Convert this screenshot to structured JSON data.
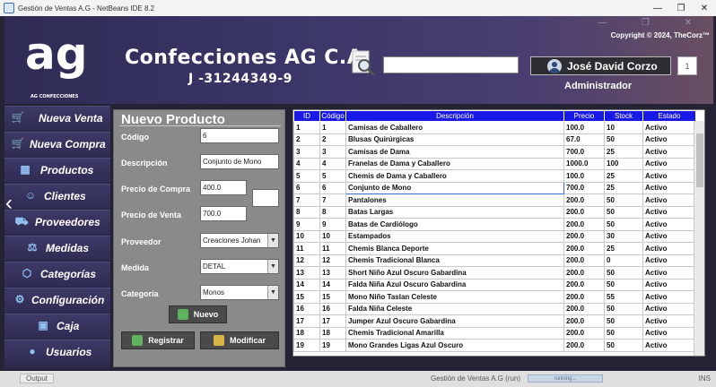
{
  "window": {
    "title": "Gestión de Ventas A.G - NetBeans IDE 8.2",
    "min": "—",
    "max": "❐",
    "close": "✕"
  },
  "header": {
    "logo": "ag",
    "logo_small": "AG CONFECCIONES",
    "company": "Confecciones AG C.A",
    "rif": "J -31244349-9",
    "copyright": "Copyright © 2024, TheCorz™",
    "search_value": "",
    "user_name": "José David Corzo",
    "count": "1",
    "role": "Administrador"
  },
  "sidebar": {
    "items": [
      {
        "label": "Nueva Venta",
        "icon": "cart-icon"
      },
      {
        "label": "Nueva Compra",
        "icon": "cart-add-icon"
      },
      {
        "label": "Productos",
        "icon": "products-icon"
      },
      {
        "label": "Clientes",
        "icon": "clients-icon"
      },
      {
        "label": "Proveedores",
        "icon": "providers-icon"
      },
      {
        "label": "Medidas",
        "icon": "measures-icon"
      },
      {
        "label": "Categorías",
        "icon": "categories-icon"
      },
      {
        "label": "Configuración",
        "icon": "gear-icon"
      },
      {
        "label": "Caja",
        "icon": "cashbox-icon"
      },
      {
        "label": "Usuarios",
        "icon": "users-icon"
      }
    ]
  },
  "form": {
    "title": "Nuevo Producto",
    "codigo_label": "Código",
    "codigo_value": "6",
    "descripcion_label": "Descripción",
    "descripcion_value": "Conjunto de Mono",
    "precio_compra_label": "Precio de Compra",
    "precio_compra_value": "400.0",
    "precio_venta_label": "Precio de Venta",
    "precio_venta_value": "700.0",
    "proveedor_label": "Proveedor",
    "proveedor_value": "Creaciones Johan",
    "medida_label": "Medida",
    "medida_value": "DETAL",
    "categoria_label": "Categoría",
    "categoria_value": "Monos",
    "nuevo_label": "Nuevo",
    "registrar_label": "Registrar",
    "modificar_label": "Modificar"
  },
  "table": {
    "headers": [
      "ID",
      "Código",
      "Descripción",
      "Precio",
      "Stock",
      "Estado"
    ],
    "rows": [
      [
        "1",
        "1",
        "Camisas de Caballero",
        "100.0",
        "10",
        "Activo"
      ],
      [
        "2",
        "2",
        "Blusas Quirúrgicas",
        "67.0",
        "50",
        "Activo"
      ],
      [
        "3",
        "3",
        "Camisas de Dama",
        "700.0",
        "25",
        "Activo"
      ],
      [
        "4",
        "4",
        "Franelas de Dama y Caballero",
        "1000.0",
        "100",
        "Activo"
      ],
      [
        "5",
        "5",
        "Chemis de Dama y Caballero",
        "100.0",
        "25",
        "Activo"
      ],
      [
        "6",
        "6",
        "Conjunto de Mono",
        "700.0",
        "25",
        "Activo"
      ],
      [
        "7",
        "7",
        "Pantalones",
        "200.0",
        "50",
        "Activo"
      ],
      [
        "8",
        "8",
        "Batas Largas",
        "200.0",
        "50",
        "Activo"
      ],
      [
        "9",
        "9",
        "Batas de Cardiólogo",
        "200.0",
        "50",
        "Activo"
      ],
      [
        "10",
        "10",
        "Estampados",
        "200.0",
        "30",
        "Activo"
      ],
      [
        "11",
        "11",
        "Chemis Blanca Deporte",
        "200.0",
        "25",
        "Activo"
      ],
      [
        "12",
        "12",
        "Chemis Tradicional Blanca",
        "200.0",
        "0",
        "Activo"
      ],
      [
        "13",
        "13",
        "Short Niño Azul Oscuro Gabardina",
        "200.0",
        "50",
        "Activo"
      ],
      [
        "14",
        "14",
        "Falda Niña Azul Oscuro Gabardina",
        "200.0",
        "50",
        "Activo"
      ],
      [
        "15",
        "15",
        "Mono Niño Taslan Celeste",
        "200.0",
        "55",
        "Activo"
      ],
      [
        "16",
        "16",
        "Falda Niña Celeste",
        "200.0",
        "50",
        "Activo"
      ],
      [
        "17",
        "17",
        "Jumper Azul Oscuro Gabardina",
        "200.0",
        "50",
        "Activo"
      ],
      [
        "18",
        "18",
        "Chemis Tradicional Amarilla",
        "200.0",
        "50",
        "Activo"
      ],
      [
        "19",
        "19",
        "Mono Grandes Ligas Azul Oscuro",
        "200.0",
        "50",
        "Activo"
      ]
    ]
  },
  "status": {
    "output": "Output",
    "running": "Gestión de Ventas A.G (run)",
    "progress": "running...",
    "ins": "INS"
  }
}
